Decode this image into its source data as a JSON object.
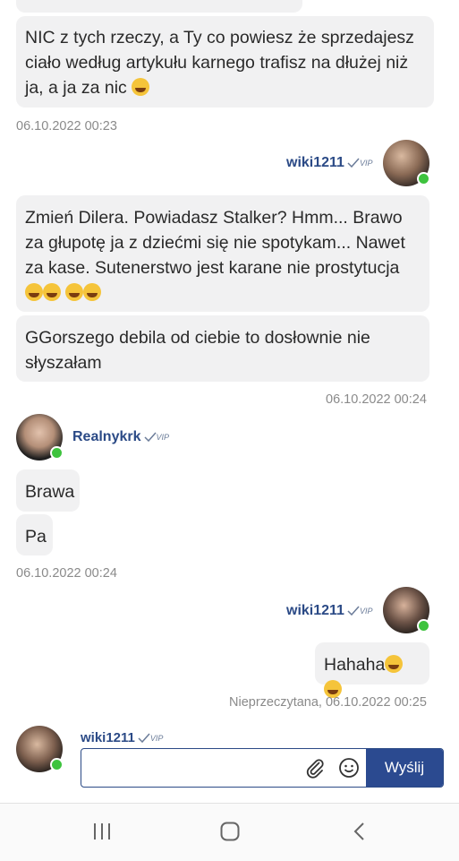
{
  "messages": {
    "m1_text": "NIC z tych rzeczy, a Ty co powiesz że sprzedajesz ciało według artykułu karnego trafisz na dłużej niż ja, a ja za nic",
    "ts1": "06.10.2022 00:23",
    "user_wiki": "wiki1211",
    "vip_label": "VIP",
    "m2_text": "Zmień Dilera. Powiadasz Stalker? Hmm... Brawo za głupotę ja z dziećmi się nie spotykam... Nawet za kase. Sutenerstwo jest karane nie prostytucja",
    "m3_text": "GGorszego debila od ciebie to dosłownie nie słyszałam",
    "ts2": "06.10.2022 00:24",
    "user_real": "Realnykrk",
    "m4_text": "Brawa",
    "m5_text": "Pa",
    "ts3": "06.10.2022 00:24",
    "m6_text": "Hahaha",
    "ts4": "Nieprzeczytana, 06.10.2022 00:25"
  },
  "composer": {
    "user": "wiki1211",
    "send_label": "Wyślij",
    "placeholder": ""
  },
  "colors": {
    "accent": "#2b4a90",
    "online": "#3ec33e",
    "bubble": "#f1f1f2"
  }
}
